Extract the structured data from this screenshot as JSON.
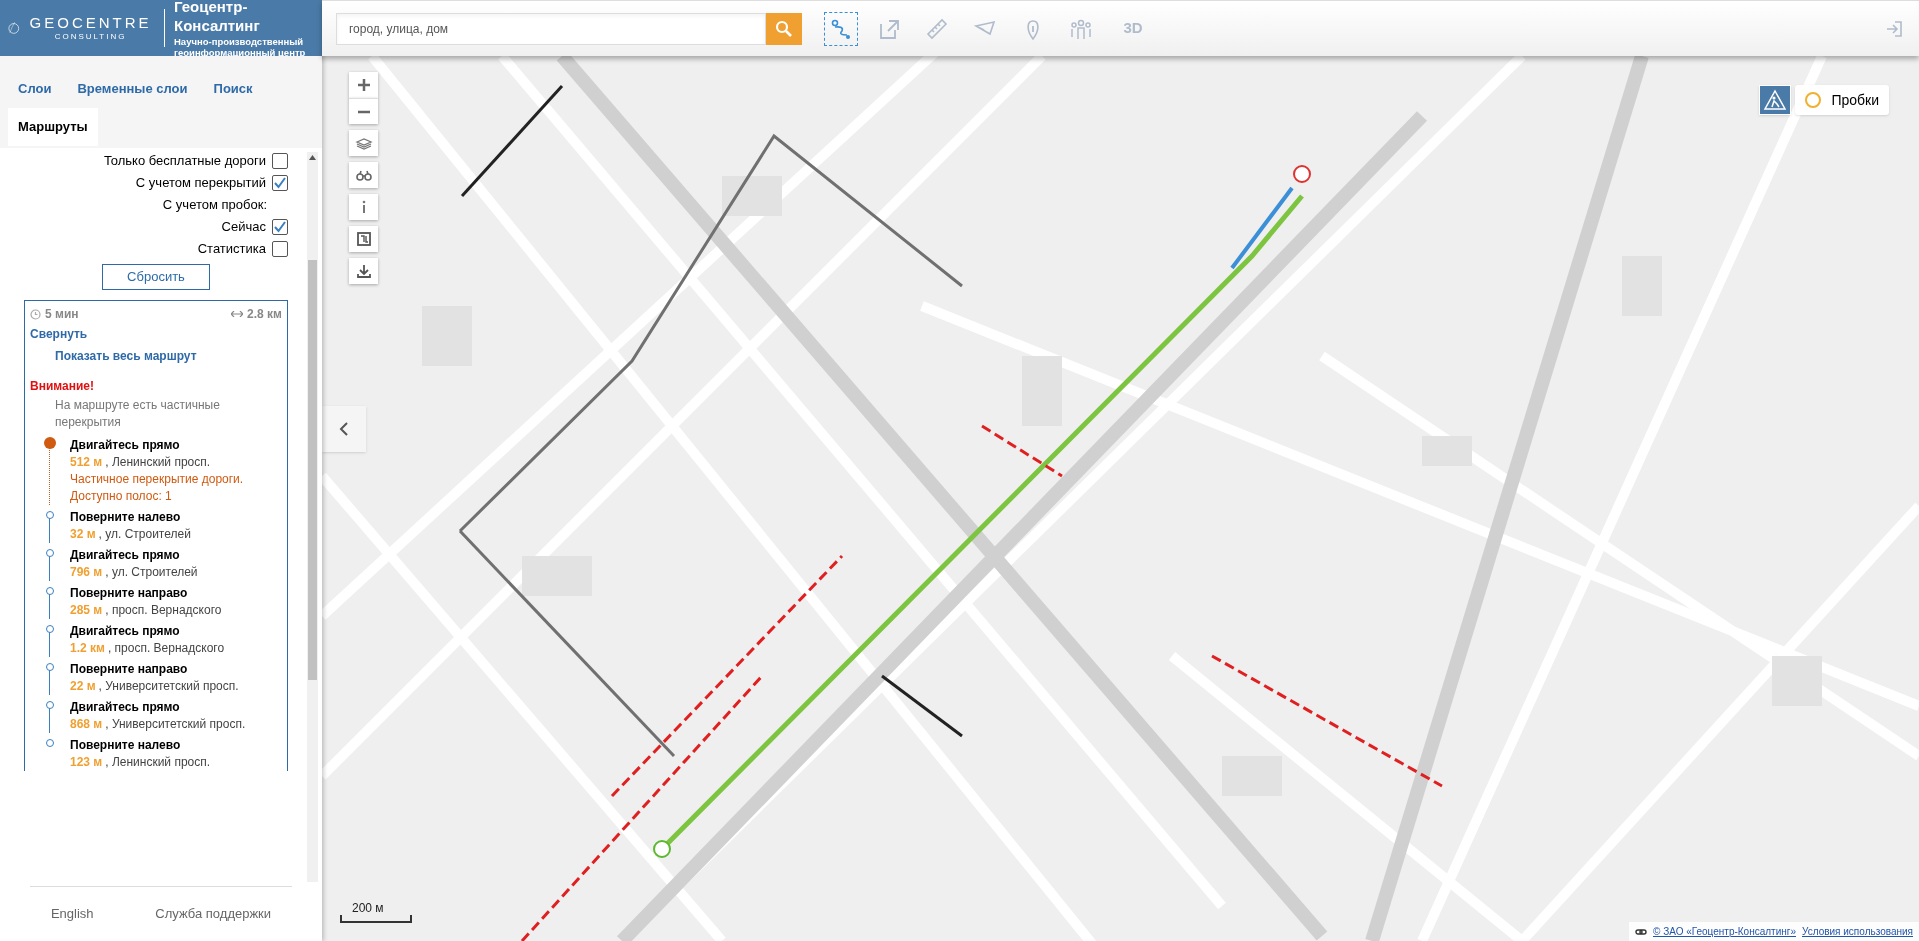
{
  "brand": {
    "logo_text": "GEOCENTRE",
    "logo_sub": "CONSULTING",
    "title": "Геоцентр-Консалтинг",
    "subtitle": "Научно-производственный геоинформационный центр"
  },
  "tabs": [
    {
      "label": "Слои",
      "selected": false
    },
    {
      "label": "Временные слои",
      "selected": false
    },
    {
      "label": "Поиск",
      "selected": false
    },
    {
      "label": "Маршруты",
      "selected": true
    }
  ],
  "options": [
    {
      "kind": "checkbox",
      "label": "Только бесплатные дороги",
      "checked": false
    },
    {
      "kind": "checkbox",
      "label": "С учетом перекрытий",
      "checked": true
    },
    {
      "kind": "heading",
      "label": "С учетом пробок:"
    },
    {
      "kind": "checkbox",
      "label": "Сейчас",
      "checked": true
    },
    {
      "kind": "checkbox",
      "label": "Статистика",
      "checked": false
    }
  ],
  "reset_button": "Сбросить",
  "route": {
    "time": "5 мин",
    "distance": "2.8 км",
    "collapse": "Свернуть",
    "show_all": "Показать весь маршрут",
    "warning_title": "Внимание!",
    "warning_text": "На маршруте есть частичные перекрытия",
    "steps": [
      {
        "instruction": "Двигайтесь прямо",
        "distance": "512 м",
        "street": ", Ленинский просп.",
        "current": true,
        "notes": [
          "Частичное перекрытие дороги.",
          "Доступно полос: 1"
        ]
      },
      {
        "instruction": "Поверните налево",
        "distance": "32 м",
        "street": ", ул. Строителей",
        "current": false
      },
      {
        "instruction": "Двигайтесь прямо",
        "distance": "796 м",
        "street": ", ул. Строителей",
        "current": false
      },
      {
        "instruction": "Поверните направо",
        "distance": "285 м",
        "street": ", просп. Вернадского",
        "current": false
      },
      {
        "instruction": "Двигайтесь прямо",
        "distance": "1.2 км",
        "street": ", просп. Вернадского",
        "current": false
      },
      {
        "instruction": "Поверните направо",
        "distance": "22 м",
        "street": ", Университетский просп.",
        "current": false
      },
      {
        "instruction": "Двигайтесь прямо",
        "distance": "868 м",
        "street": ", Университетский просп.",
        "current": false
      },
      {
        "instruction": "Поверните налево",
        "distance": "123 м",
        "street": ", Ленинский просп.",
        "current": false
      }
    ]
  },
  "footer": [
    "English",
    "Служба поддержки"
  ],
  "search": {
    "placeholder": "город, улица, дом"
  },
  "tools": [
    {
      "kind": "route",
      "selected": true
    },
    {
      "kind": "external",
      "selected": false
    },
    {
      "kind": "ruler",
      "selected": false
    },
    {
      "kind": "polygon",
      "selected": false
    },
    {
      "kind": "info",
      "selected": false
    },
    {
      "kind": "people",
      "selected": false
    },
    {
      "kind": "text",
      "label": "3D",
      "selected": false
    }
  ],
  "traffic": {
    "label": "Пробки",
    "on": false
  },
  "scale": "200 м",
  "attribution": {
    "copyright": "© ЗАО «Геоцентр-Консалтинг»",
    "terms": "Условия использования"
  }
}
